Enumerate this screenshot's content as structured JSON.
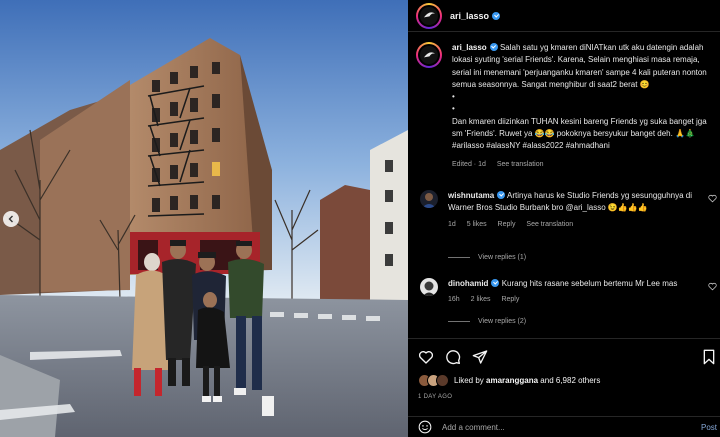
{
  "post": {
    "author": "ari_lasso",
    "verified": true,
    "photo_alt_theme": "street corner with apartment building and group of people"
  },
  "caption": {
    "author": "ari_lasso",
    "text_1": "Salah satu yg kmaren diNIATkan utk aku datengin adalah lokasi syuting 'serial Friends'. Karena, Selain menghiasi masa remaja, serial ini menemani 'perjuanganku kmaren' sampe 4 kali puteran nonton semua seasonnya. Sangat menghibur di saat2 berat 😊",
    "bullet_1": "•",
    "bullet_2": "•",
    "text_2": "Dan kmaren diizinkan TUHAN kesini bareng Friends yg suka banget jga sm 'Friends'. Ruwet ya 😂😂 pokoknya bersyukur banget deh. 🙏🎄 #arilasso #alassNY #alass2022 #ahmadhani",
    "edited": "Edited · 1d",
    "see_translation": "See translation"
  },
  "comments": [
    {
      "user": "wishnutama",
      "verified": true,
      "text": "Artinya harus ke Studio Friends yg sesungguhnya di Warner Bros Studio Burbank bro @ari_lasso 😉👍👍👍",
      "age": "1d",
      "likes": "5 likes",
      "reply": "Reply",
      "see_translation": "See translation",
      "view_replies": "View replies (1)"
    },
    {
      "user": "dinohamid",
      "verified": true,
      "text": "Kurang hits rasane sebelum bertemu Mr Lee mas",
      "age": "16h",
      "likes": "2 likes",
      "reply": "Reply",
      "view_replies": "View replies (2)"
    }
  ],
  "likes_line": {
    "prefix": "Liked by",
    "user": "amaranggana",
    "suffix": "and 6,982 others"
  },
  "time_ago": "1 DAY AGO",
  "comment_box": {
    "placeholder": "Add a comment...",
    "post_label": "Post"
  },
  "colors": {
    "background": "#000000",
    "verified": "#3897f0",
    "post_button": "#85a7d6",
    "muted_text": "#a8a8a8"
  }
}
